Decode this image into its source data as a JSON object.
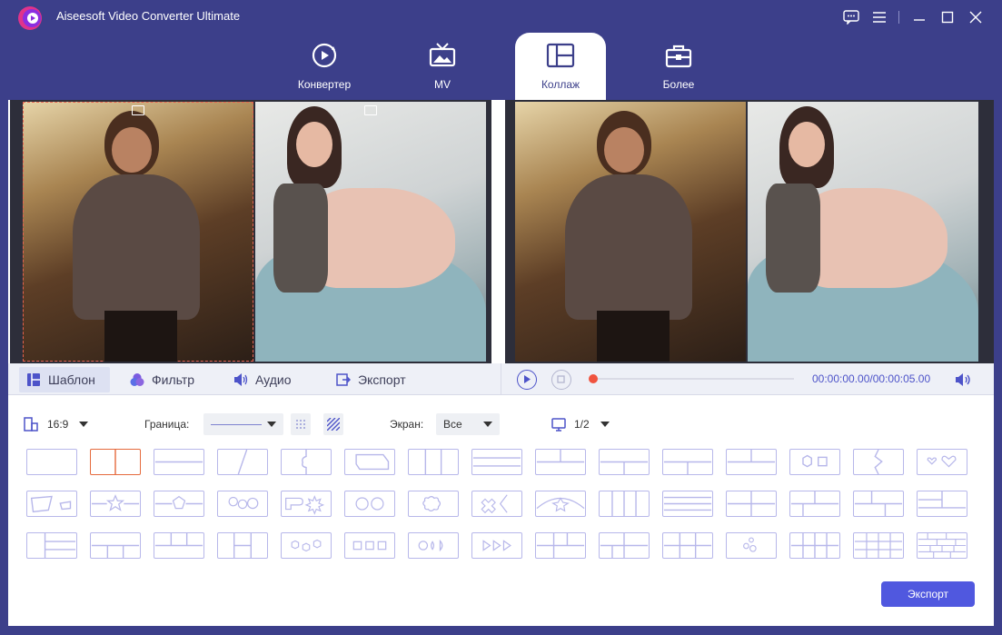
{
  "app": {
    "title": "Aiseesoft Video Converter Ultimate"
  },
  "nav": [
    {
      "label": "Конвертер",
      "icon": "convert-icon"
    },
    {
      "label": "MV",
      "icon": "mv-icon"
    },
    {
      "label": "Коллаж",
      "icon": "collage-icon",
      "active": true
    },
    {
      "label": "Более",
      "icon": "toolbox-icon"
    }
  ],
  "tabs": [
    {
      "label": "Шаблон",
      "icon": "template-icon",
      "active": true
    },
    {
      "label": "Фильтр",
      "icon": "filter-icon"
    },
    {
      "label": "Аудио",
      "icon": "audio-icon"
    },
    {
      "label": "Экспорт",
      "icon": "export-icon"
    }
  ],
  "playback": {
    "time": "00:00:00.00/00:00:05.00",
    "progress": 0
  },
  "options": {
    "aspect": "16:9",
    "border_label": "Граница:",
    "screen_label": "Экран:",
    "screen_value": "Все",
    "page": "1/2"
  },
  "templates": {
    "rows": 3,
    "per_row": 15,
    "selected_index": 1
  },
  "export_label": "Экспорт",
  "colors": {
    "brand": "#3c3f8a",
    "accent": "#5058df",
    "selected": "#e56a3d",
    "template_stroke": "#b7b7ea"
  }
}
